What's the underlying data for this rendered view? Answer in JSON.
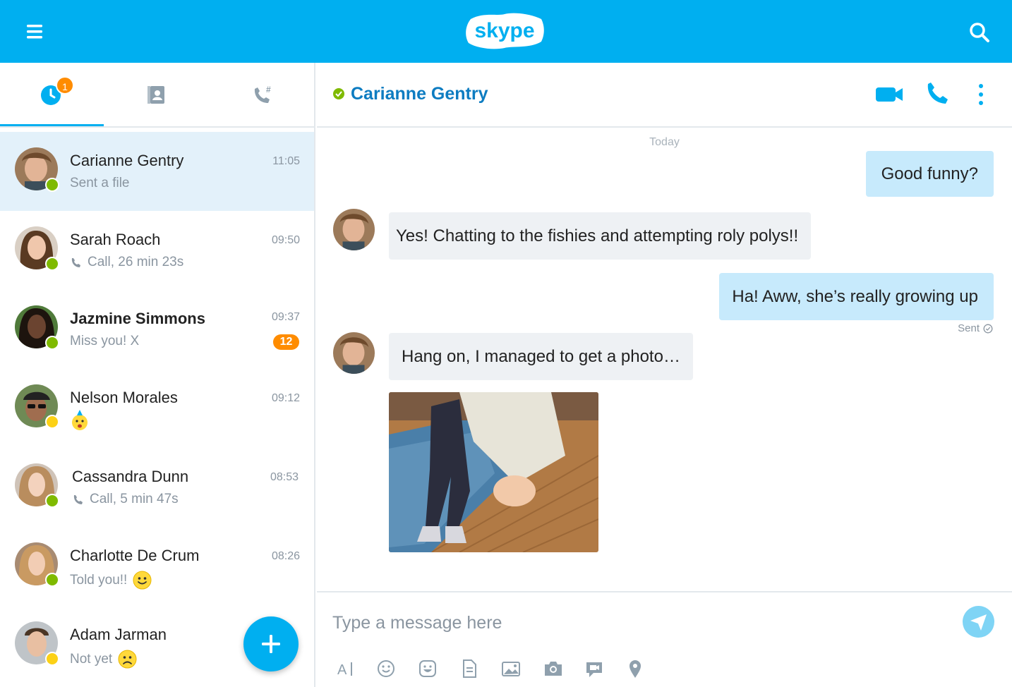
{
  "app": {
    "brand": "skype",
    "colors": {
      "accent": "#00aff0",
      "header_name": "#0d7cc1",
      "online": "#7fba00",
      "away": "#fcd116",
      "badge": "#ff8c00"
    }
  },
  "topbar": {
    "menu_icon": "hamburger-menu-icon",
    "search_icon": "search-icon"
  },
  "tabs": {
    "recent_badge": "1",
    "items": [
      {
        "icon": "recents-clock-icon",
        "active": true
      },
      {
        "icon": "contacts-book-icon",
        "active": false
      },
      {
        "icon": "dialpad-phone-icon",
        "active": false
      }
    ]
  },
  "conversations": [
    {
      "name": "Carianne Gentry",
      "subtitle": "Sent a file",
      "time": "11:05",
      "presence": "online",
      "active": true
    },
    {
      "name": "Sarah Roach",
      "subtitle": "Call, 26 min 23s",
      "time": "09:50",
      "presence": "online",
      "sub_icon": "phone-icon"
    },
    {
      "name": "Jazmine Simmons",
      "subtitle": "Miss you! X",
      "time": "09:37",
      "presence": "online",
      "unread": "12",
      "bold": true
    },
    {
      "name": "Nelson Morales",
      "subtitle": "",
      "time": "09:12",
      "presence": "away",
      "sub_icon": "party-emoji-icon"
    },
    {
      "name": "Cassandra Dunn",
      "subtitle": "Call, 5 min 47s",
      "time": "08:53",
      "presence": "online",
      "sub_icon": "phone-icon"
    },
    {
      "name": "Charlotte De Crum",
      "subtitle": "Told you!!",
      "time": "08:26",
      "presence": "online",
      "sub_icon": "smile-emoji-icon"
    },
    {
      "name": "Adam Jarman",
      "subtitle": "Not yet",
      "time": "",
      "presence": "away",
      "sub_icon": "sad-emoji-icon"
    }
  ],
  "chat": {
    "contact_name": "Carianne Gentry",
    "day_divider": "Today",
    "messages": [
      {
        "direction": "out",
        "text": "Good funny?"
      },
      {
        "direction": "in",
        "text": "Yes! Chatting to the fishies and attempting roly polys!!"
      },
      {
        "direction": "out",
        "text": "Ha! Aww, she’s really growing up",
        "status": "Sent"
      },
      {
        "direction": "in",
        "text": "Hang on, I managed to get a photo…"
      },
      {
        "direction": "in",
        "type": "photo",
        "icon": "photo-image"
      }
    ]
  },
  "composer": {
    "placeholder": "Type a message here",
    "tools": [
      "text-format-icon",
      "emoticon-icon",
      "sticker-icon",
      "file-icon",
      "media-icon",
      "camera-icon",
      "video-message-icon",
      "location-icon"
    ]
  }
}
